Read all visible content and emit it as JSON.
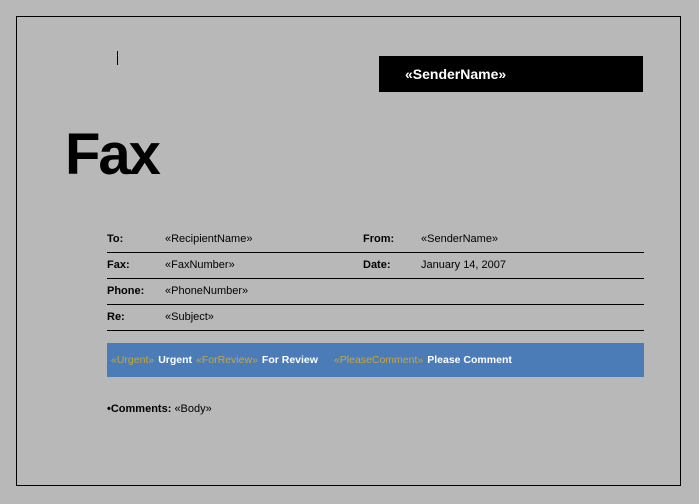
{
  "header": {
    "sender_box": "«SenderName»",
    "title": "Fax"
  },
  "info": {
    "to_label": "To:",
    "to_value": "«RecipientName»",
    "from_label": "From:",
    "from_value": "«SenderName»",
    "fax_label": "Fax:",
    "fax_value": "«FaxNumber»",
    "date_label": "Date:",
    "date_value": "January 14, 2007",
    "phone_label": "Phone:",
    "phone_value": "«PhoneNumber»",
    "re_label": "Re:",
    "re_value": "«Subject»"
  },
  "flags": {
    "urgent_merge": "«Urgent»",
    "urgent_label": "Urgent",
    "forreview_merge": "«ForReview»",
    "forreview_label": "For Review",
    "pleasecomment_merge": "«PleaseComment»",
    "pleasecomment_label": "Please Comment"
  },
  "comments": {
    "bullet": "•",
    "label": "Comments:",
    "value": "«Body»"
  }
}
